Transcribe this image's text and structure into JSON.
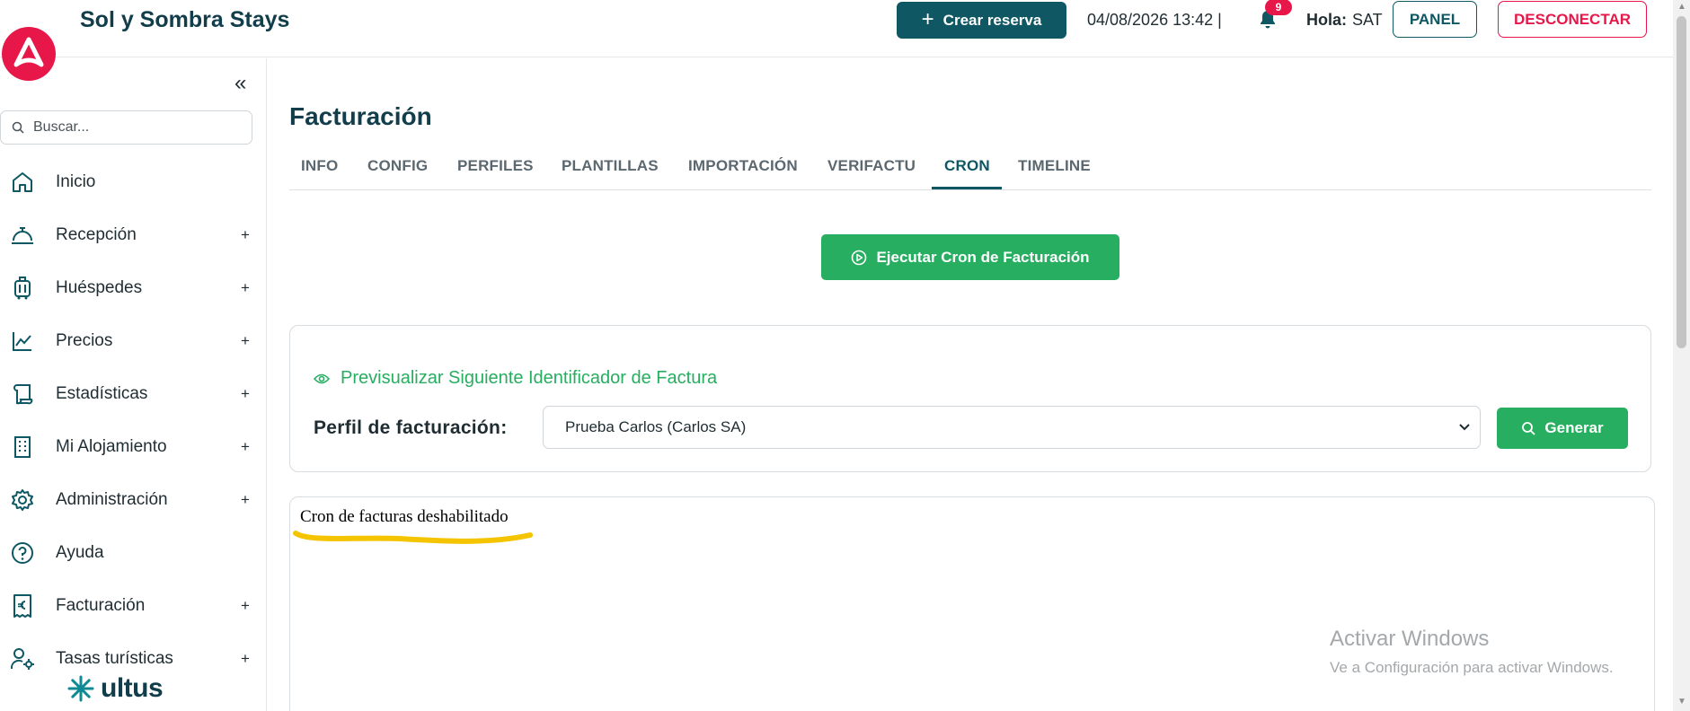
{
  "header": {
    "app_title": "Sol y Sombra Stays",
    "create_button": "Crear reserva",
    "datetime": "04/08/2026 13:42 |",
    "notifications_count": "9",
    "greeting_label": "Hola:",
    "greeting_user": "SAT",
    "panel_button": "PANEL",
    "logout_button": "DESCONECTAR"
  },
  "sidebar": {
    "search_placeholder": "Buscar...",
    "items": [
      {
        "label": "Inicio",
        "icon": "home-icon",
        "expandable": false
      },
      {
        "label": "Recepción",
        "icon": "bell-desk-icon",
        "expandable": true
      },
      {
        "label": "Huéspedes",
        "icon": "luggage-icon",
        "expandable": true
      },
      {
        "label": "Precios",
        "icon": "chart-line-icon",
        "expandable": true
      },
      {
        "label": "Estadísticas",
        "icon": "scroll-icon",
        "expandable": true
      },
      {
        "label": "Mi Alojamiento",
        "icon": "building-icon",
        "expandable": true
      },
      {
        "label": "Administración",
        "icon": "gear-icon",
        "expandable": true
      },
      {
        "label": "Ayuda",
        "icon": "help-circle-icon",
        "expandable": false
      },
      {
        "label": "Facturación",
        "icon": "receipt-euro-icon",
        "expandable": true
      },
      {
        "label": "Tasas turísticas",
        "icon": "user-gear-icon",
        "expandable": true
      }
    ],
    "plus_symbol": "+",
    "brand": "ultus"
  },
  "main": {
    "page_title": "Facturación",
    "tabs": [
      {
        "label": "INFO",
        "active": false
      },
      {
        "label": "CONFIG",
        "active": false
      },
      {
        "label": "PERFILES",
        "active": false
      },
      {
        "label": "PLANTILLAS",
        "active": false
      },
      {
        "label": "IMPORTACIÓN",
        "active": false
      },
      {
        "label": "VERIFACTU",
        "active": false
      },
      {
        "label": "CRON",
        "active": true
      },
      {
        "label": "TIMELINE",
        "active": false
      }
    ],
    "run_button": "Ejecutar Cron de Facturación",
    "preview_link": "Previsualizar Siguiente Identificador de Factura",
    "profile_label": "Perfil de facturación:",
    "profile_value": "Prueba Carlos (Carlos SA)",
    "generate_button": "Generar",
    "output_text": "Cron de facturas deshabilitado"
  },
  "watermark": {
    "line1": "Activar Windows",
    "line2": "Ve a Configuración para activar Windows."
  },
  "colors": {
    "brand_teal": "#0e5763",
    "brand_pink": "#e8174a",
    "success_green": "#27ae60",
    "highlight_yellow": "#f5c400"
  }
}
